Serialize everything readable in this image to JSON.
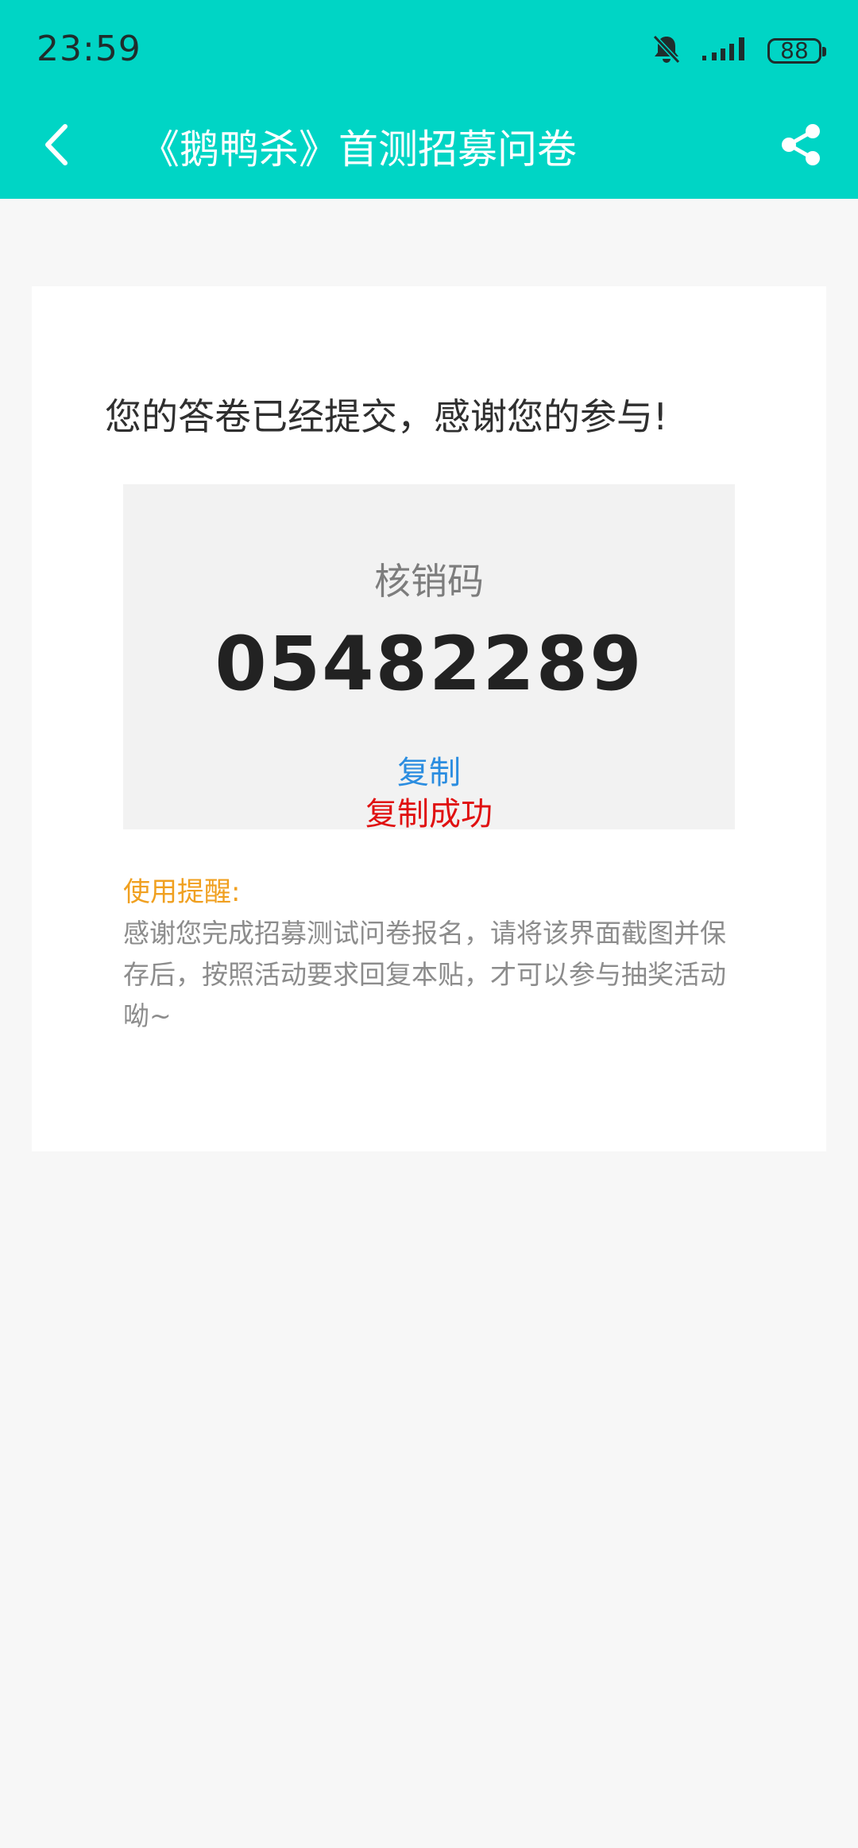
{
  "status_bar": {
    "time": "23:59",
    "battery": "88",
    "icons": [
      "bell-off-icon",
      "signal-icon",
      "battery-icon"
    ]
  },
  "nav": {
    "title": "《鹅鸭杀》首测招募问卷",
    "back_icon": "chevron-left-icon",
    "share_icon": "share-icon"
  },
  "colors": {
    "header": "#00d5c5",
    "page_bg": "#f7f7f7",
    "copy_link": "#2b8de0",
    "copy_success": "#e01010",
    "reminder_title": "#f0a020"
  },
  "card": {
    "message": "您的答卷已经提交，感谢您的参与!",
    "code_label": "核销码",
    "code_value": "05482289",
    "copy_label": "复制",
    "copy_status": "复制成功",
    "reminder_title": "使用提醒:",
    "reminder_text": "感谢您完成招募测试问卷报名，请将该界面截图并保存后，按照活动要求回复本贴，才可以参与抽奖活动呦~"
  }
}
